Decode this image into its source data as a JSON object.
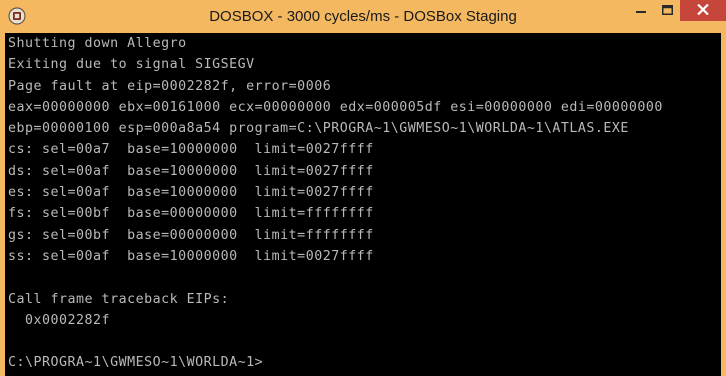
{
  "window": {
    "title": "DOSBOX - 3000 cycles/ms - DOSBox Staging"
  },
  "titlebar_buttons": {
    "minimize": "minimize-icon",
    "maximize": "maximize-icon",
    "close": "close-icon"
  },
  "colors": {
    "titlebar": "#f4b860",
    "console_bg": "#000000",
    "console_text": "#b9b9b9",
    "close_button": "#c7463c"
  },
  "console": {
    "lines": [
      "Shutting down Allegro",
      "Exiting due to signal SIGSEGV",
      "Page fault at eip=0002282f, error=0006",
      "eax=00000000 ebx=00161000 ecx=00000000 edx=000005df esi=00000000 edi=00000000",
      "ebp=00000100 esp=000a8a54 program=C:\\PROGRA~1\\GWMESO~1\\WORLDA~1\\ATLAS.EXE",
      "cs: sel=00a7  base=10000000  limit=0027ffff",
      "ds: sel=00af  base=10000000  limit=0027ffff",
      "es: sel=00af  base=10000000  limit=0027ffff",
      "fs: sel=00bf  base=00000000  limit=ffffffff",
      "gs: sel=00bf  base=00000000  limit=ffffffff",
      "ss: sel=00af  base=10000000  limit=0027ffff",
      "",
      "Call frame traceback EIPs:",
      "  0x0002282f",
      "",
      "C:\\PROGRA~1\\GWMESO~1\\WORLDA~1>"
    ]
  }
}
